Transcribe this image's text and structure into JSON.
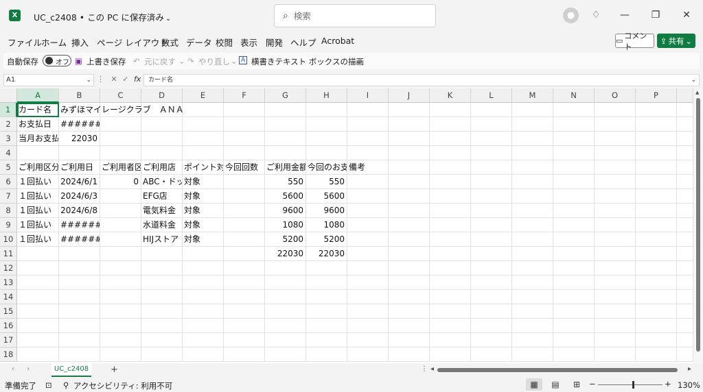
{
  "titlebar": {
    "app_logo": "X",
    "doc_title": "UC_c2408 • この PC に保存済み",
    "search_placeholder": "検索",
    "minimize": "—",
    "restore": "❐",
    "close": "✕"
  },
  "menu": {
    "items": [
      "ファイル",
      "ホーム",
      "挿入",
      "ページ レイアウト",
      "数式",
      "データ",
      "校閲",
      "表示",
      "開発",
      "ヘルプ",
      "Acrobat"
    ],
    "comment_label": "コメント",
    "share_label": "共有"
  },
  "qat": {
    "autosave_label": "自動保存",
    "autosave_state": "オフ",
    "save_label": "上書き保存",
    "undo_label": "元に戻す",
    "redo_label": "やり直し",
    "textbox_label": "横書きテキスト ボックスの描画"
  },
  "formula_bar": {
    "name_box": "A1",
    "formula": "カード名"
  },
  "grid": {
    "columns": [
      "A",
      "B",
      "C",
      "D",
      "E",
      "F",
      "G",
      "H",
      "I",
      "J",
      "K",
      "L",
      "M",
      "N",
      "O",
      "P"
    ],
    "rows": [
      "1",
      "2",
      "3",
      "4",
      "5",
      "6",
      "7",
      "8",
      "9",
      "10",
      "11",
      "12",
      "13",
      "14",
      "15",
      "16",
      "17",
      "18"
    ],
    "cells": {
      "r1": [
        "カード名",
        "みずほマイレージクラブ　ＡＮＡ",
        "",
        "",
        "",
        "",
        "",
        "",
        ""
      ],
      "r2": [
        "お支払日",
        "#######",
        "",
        "",
        "",
        "",
        "",
        "",
        ""
      ],
      "r3": [
        "当月お支払",
        "22030",
        "",
        "",
        "",
        "",
        "",
        "",
        ""
      ],
      "r4": [
        "",
        "",
        "",
        "",
        "",
        "",
        "",
        "",
        ""
      ],
      "r5": [
        "ご利用区分",
        "ご利用日",
        "ご利用者区",
        "ご利用店",
        "ポイント対",
        "今回回数",
        "ご利用金額",
        "今回のお支",
        "備考"
      ],
      "r6": [
        "１回払い",
        "2024/6/1",
        "0",
        "ABC・ドッ",
        "対象",
        "",
        "550",
        "550",
        ""
      ],
      "r7": [
        "１回払い",
        "2024/6/3",
        "",
        "EFG店",
        "対象",
        "",
        "5600",
        "5600",
        ""
      ],
      "r8": [
        "１回払い",
        "2024/6/8",
        "",
        "電気料金",
        "対象",
        "",
        "9600",
        "9600",
        ""
      ],
      "r9": [
        "１回払い",
        "#######",
        "",
        "水道料金",
        "対象",
        "",
        "1080",
        "1080",
        ""
      ],
      "r10": [
        "１回払い",
        "#######",
        "",
        "HIJストア",
        "対象",
        "",
        "5200",
        "5200",
        ""
      ],
      "r11": [
        "",
        "",
        "",
        "",
        "",
        "",
        "22030",
        "22030",
        ""
      ]
    }
  },
  "sheet": {
    "tab_name": "UC_c2408",
    "add": "+"
  },
  "status": {
    "ready": "準備完了",
    "accessibility": "アクセシビリティ: 利用不可",
    "zoom": "130%"
  }
}
